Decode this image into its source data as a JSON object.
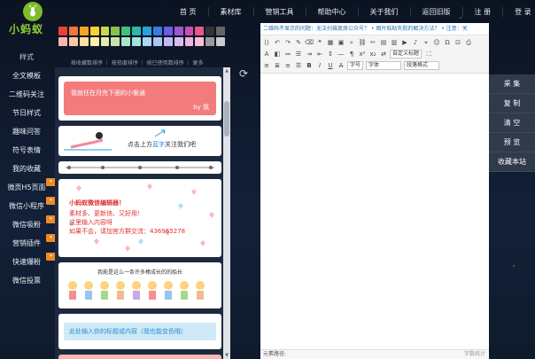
{
  "logo": {
    "text": "小蚂蚁",
    "icon": "ant-icon"
  },
  "nav": [
    "首 页",
    "素材库",
    "营销工具",
    "帮助中心",
    "关于我们",
    "返回旧版",
    "注 册",
    "登 录"
  ],
  "sidebar": {
    "title": "样式",
    "items": [
      {
        "label": "全文模板",
        "hot": false
      },
      {
        "label": "二维码关注",
        "hot": false
      },
      {
        "label": "节日样式",
        "hot": false
      },
      {
        "label": "趣味问答",
        "hot": false
      },
      {
        "label": "符号表情",
        "hot": false
      },
      {
        "label": "我的收藏",
        "hot": false
      },
      {
        "label": "微页H5页面",
        "hot": true
      },
      {
        "label": "微信小程序",
        "hot": true
      },
      {
        "label": "微信吸粉",
        "hot": true
      },
      {
        "label": "营销插件",
        "hot": true
      },
      {
        "label": "快速爆粉",
        "hot": true
      },
      {
        "label": "微信投票",
        "hot": false
      }
    ]
  },
  "palette": {
    "row1": [
      "#e6423a",
      "#f1743a",
      "#f5a623",
      "#f8d12f",
      "#c6d94a",
      "#89c24a",
      "#3ec27a",
      "#2bb8a8",
      "#27a3d9",
      "#3a7be0",
      "#6b5ce6",
      "#9b59d0",
      "#c94fb3",
      "#e65a8a",
      "#333333",
      "#666666"
    ],
    "row2": [
      "#f7b7b2",
      "#f9c9a6",
      "#fbe0a0",
      "#fcf1a8",
      "#e2ecb0",
      "#c6e4b0",
      "#a8e6c8",
      "#a4e2db",
      "#a8d8f0",
      "#a9c5f3",
      "#c2b9f4",
      "#d7bdee",
      "#ebb7e0",
      "#f6bfd3",
      "#999999",
      "#cccccc"
    ]
  },
  "sort_tabs": "按收藏数排序 ｜ 按热度排序 ｜ 按已使用数排序 ｜ 更多",
  "templates": {
    "card1": {
      "line1": "我就任在月完下面的小衡通",
      "line2": "by 我"
    },
    "card2": {
      "text_prefix": "点击上方",
      "text_highlight": "蓝字",
      "text_suffix": "关注我们吧"
    },
    "card4": {
      "title": "小蚂蚁微信编辑器！",
      "line1": "素材多、更新快、又好用！",
      "line2": "这里输入内容呀",
      "line3": "如果不会，请加官方群交流：436965278"
    },
    "card5": {
      "caption": "我能是这么一条许多棒成长的的船长"
    },
    "card6": {
      "text": "此处输入你的标题或内容（我也能变色哦）"
    }
  },
  "editor": {
    "ticker": "二维码不显示的问题：无法扫描复原公众号？   •   图片粘贴失败的解决方法？   •   注意：关",
    "font_size_label": "字号",
    "font_family_label": "字体",
    "custom_title_label": "自定义标题",
    "para_format_label": "段落格式",
    "footer_path_label": "元素路径:",
    "footer_wordcount": "字数统计"
  },
  "actions": [
    "采 集",
    "复 制",
    "清 空",
    "预 览",
    "收藏本站"
  ]
}
